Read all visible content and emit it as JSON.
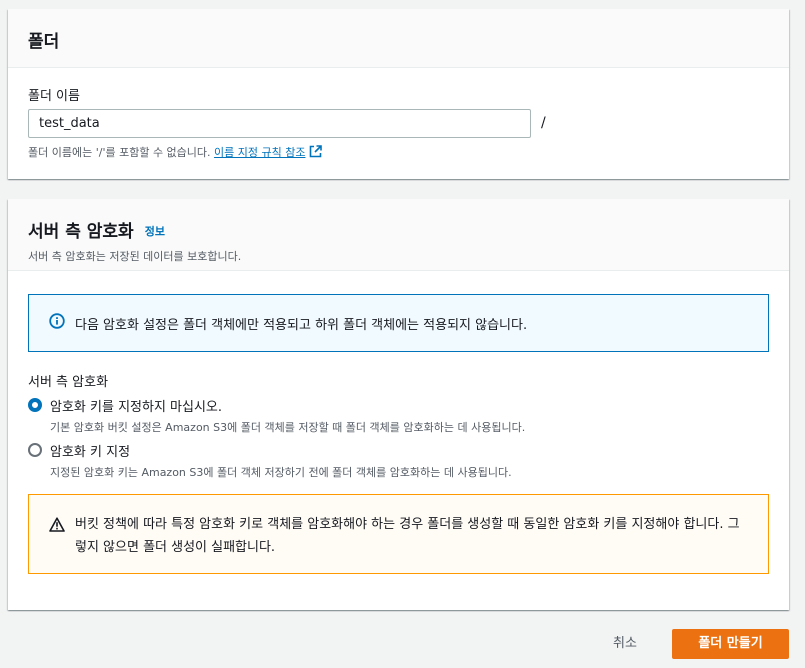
{
  "folder_panel": {
    "title": "폴더",
    "name_label": "폴더 이름",
    "name_value": "test_data",
    "slash": "/",
    "hint_text": "폴더 이름에는 '/'를 포함할 수 없습니다.",
    "hint_link": "이름 지정 규칙 참조",
    "hint_link_icon": "external-link-icon"
  },
  "encryption_panel": {
    "title": "서버 측 암호화",
    "info_link": "정보",
    "description": "서버 측 암호화는 저장된 데이터를 보호합니다.",
    "info_alert": {
      "icon": "info-icon",
      "text": "다음 암호화 설정은 폴더 객체에만 적용되고 하위 폴더 객체에는 적용되지 않습니다."
    },
    "group_label": "서버 측 암호화",
    "options": [
      {
        "title": "암호화 키를 지정하지 마십시오.",
        "desc": "기본 암호화 버킷 설정은 Amazon S3에 폴더 객체를 저장할 때 폴더 객체를 암호화하는 데 사용됩니다.",
        "selected": true
      },
      {
        "title": "암호화 키 지정",
        "desc": "지정된 암호화 키는 Amazon S3에 폴더 객체 저장하기 전에 폴더 객체를 암호화하는 데 사용됩니다.",
        "selected": false
      }
    ],
    "warning_alert": {
      "icon": "warning-icon",
      "text": "버킷 정책에 따라 특정 암호화 키로 객체를 암호화해야 하는 경우 폴더를 생성할 때 동일한 암호화 키를 지정해야 합니다. 그렇지 않으면 폴더 생성이 실패합니다."
    }
  },
  "actions": {
    "cancel_label": "취소",
    "create_label": "폴더 만들기"
  },
  "colors": {
    "link": "#0073bb",
    "primary_button": "#ec7211",
    "warning_border": "#ff9900",
    "info_border": "#0073bb"
  }
}
